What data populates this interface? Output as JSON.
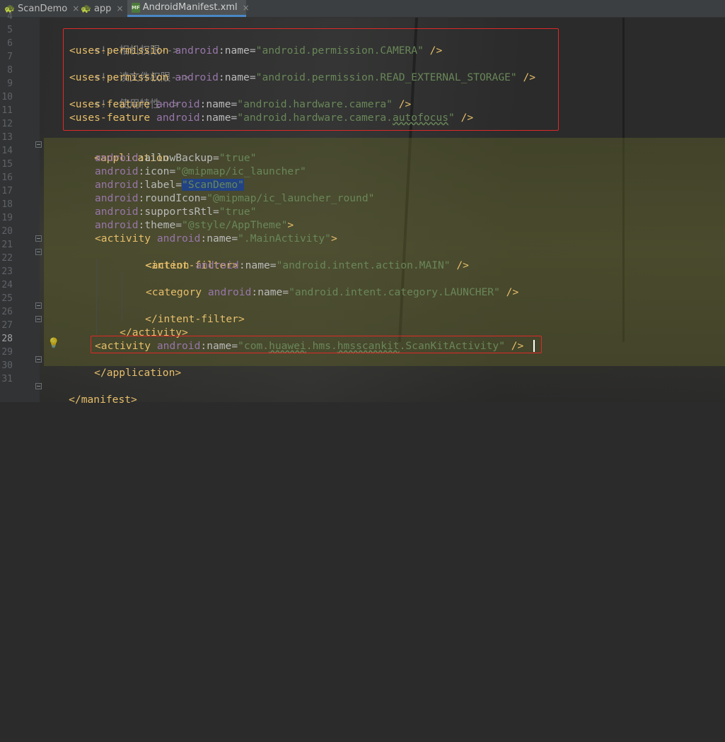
{
  "tabs": [
    {
      "label": "ScanDemo",
      "icon": "android-module-icon",
      "active": false
    },
    {
      "label": "app",
      "icon": "android-module-icon",
      "active": false
    },
    {
      "label": "AndroidManifest.xml",
      "icon": "manifest-file-icon",
      "badge": "MF",
      "active": true
    }
  ],
  "close_glyph": "×",
  "line_numbers": [
    "4",
    "5",
    "6",
    "7",
    "8",
    "9",
    "10",
    "11",
    "12",
    "13",
    "14",
    "15",
    "16",
    "17",
    "18",
    "19",
    "20",
    "21",
    "22",
    "23",
    "24",
    "25",
    "26",
    "27",
    "28",
    "29",
    "30",
    "31"
  ],
  "current_line": "28",
  "code": {
    "l5": {
      "comment": "<!--相机权限-->"
    },
    "l6": {
      "tag": "<uses-permission",
      "ns": "android",
      "colon": ":",
      "attr": "name",
      "eq": "=",
      "val": "\"android.permission.CAMERA\"",
      "end": " />"
    },
    "l7": {
      "comment": "<!--读文件权限-->"
    },
    "l8": {
      "tag": "<uses-permission",
      "ns": "android",
      "colon": ":",
      "attr": "name",
      "eq": "=",
      "val": "\"android.permission.READ_EXTERNAL_STORAGE\"",
      "end": " />"
    },
    "l9": {
      "comment": "<!--使用特性-->"
    },
    "l10": {
      "tag": "<uses-feature",
      "ns": "android",
      "colon": ":",
      "attr": "name",
      "eq": "=",
      "val": "\"android.hardware.camera\"",
      "end": " />"
    },
    "l11": {
      "tag": "<uses-feature",
      "ns": "android",
      "colon": ":",
      "attr": "name",
      "eq": "=",
      "val_a": "\"android.hardware.camera.",
      "val_b": "autofocus",
      "val_c": "\"",
      "end": " />"
    },
    "l13": {
      "tag": "<application"
    },
    "l14": {
      "ns": "android",
      "colon": ":",
      "attr": "allowBackup",
      "eq": "=",
      "val": "\"true\""
    },
    "l15": {
      "ns": "android",
      "colon": ":",
      "attr": "icon",
      "eq": "=",
      "val": "\"@mipmap/ic_launcher\""
    },
    "l16": {
      "ns": "android",
      "colon": ":",
      "attr": "label",
      "eq": "=",
      "val": "\"ScanDemo\""
    },
    "l17": {
      "ns": "android",
      "colon": ":",
      "attr": "roundIcon",
      "eq": "=",
      "val": "\"@mipmap/ic_launcher_round\""
    },
    "l18": {
      "ns": "android",
      "colon": ":",
      "attr": "supportsRtl",
      "eq": "=",
      "val": "\"true\""
    },
    "l19": {
      "ns": "android",
      "colon": ":",
      "attr": "theme",
      "eq": "=",
      "val": "\"@style/AppTheme\"",
      "end": ">"
    },
    "l20": {
      "tag": "<activity",
      "ns": "android",
      "colon": ":",
      "attr": "name",
      "eq": "=",
      "val": "\".MainActivity\"",
      "end": ">"
    },
    "l21": {
      "tag": "<intent-filter>"
    },
    "l22": {
      "tag": "<action",
      "ns": "android",
      "colon": ":",
      "attr": "name",
      "eq": "=",
      "val": "\"android.intent.action.MAIN\"",
      "end": " />"
    },
    "l24": {
      "tag": "<category",
      "ns": "android",
      "colon": ":",
      "attr": "name",
      "eq": "=",
      "val": "\"android.intent.category.LAUNCHER\"",
      "end": " />"
    },
    "l25": {
      "tag": "</intent-filter>"
    },
    "l26": {
      "tag": "</activity>"
    },
    "l28": {
      "tag": "<activity",
      "ns": "android",
      "colon": ":",
      "attr": "name",
      "eq": "=",
      "val_a": "\"com.",
      "val_b": "huawei",
      "val_c": ".hms.",
      "val_d": "hmsscankit",
      "val_e": ".ScanKitActivity\"",
      "end": " />"
    },
    "l29": {
      "tag": "</application>"
    },
    "l31": {
      "tag": "</manifest>"
    }
  },
  "colors": {
    "editor_bg": "#2b2b2b",
    "tag": "#e8bf6a",
    "namespace": "#9876aa",
    "value": "#6a8759",
    "comment": "#808080",
    "annotation_box": "#e02828"
  }
}
